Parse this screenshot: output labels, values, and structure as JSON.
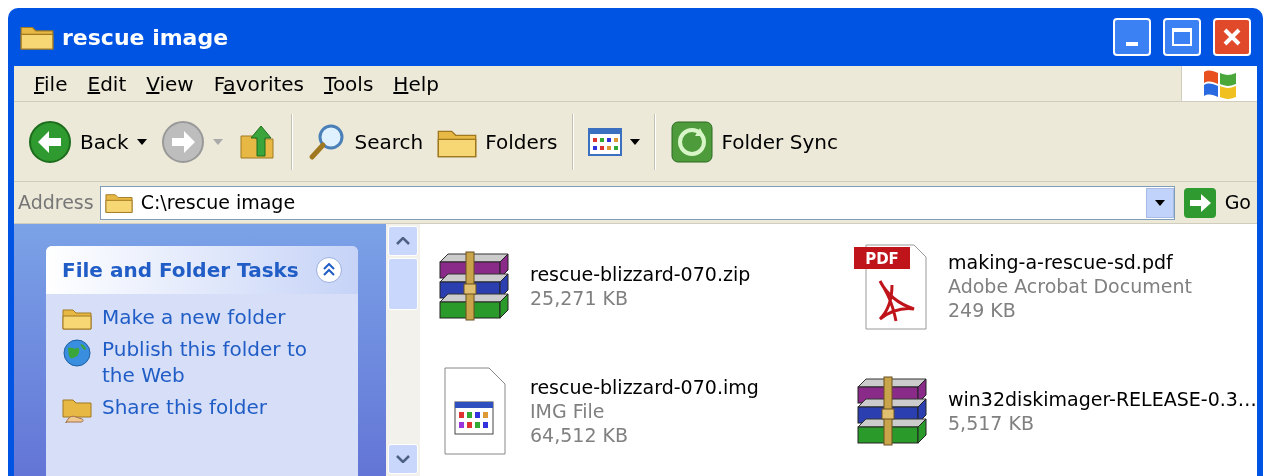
{
  "window": {
    "title": "rescue image"
  },
  "menu": [
    {
      "key": "F",
      "after": "ile"
    },
    {
      "key": "E",
      "after": "dit"
    },
    {
      "key": "V",
      "after": "iew"
    },
    {
      "before": "F",
      "key": "a",
      "after": "vorites"
    },
    {
      "key": "T",
      "after": "ools"
    },
    {
      "key": "H",
      "after": "elp"
    }
  ],
  "toolbar": [
    {
      "kind": "back",
      "label": "Back",
      "disabled": false
    },
    {
      "kind": "forward",
      "disabled": true
    },
    {
      "kind": "up"
    },
    {
      "kind": "search",
      "label": "Search"
    },
    {
      "kind": "folders",
      "label": "Folders"
    },
    {
      "kind": "views"
    },
    {
      "kind": "sync",
      "label": "Folder Sync"
    }
  ],
  "address": {
    "label": "Address",
    "value": "C:\\rescue image",
    "go": "Go"
  },
  "tasks": {
    "title": "File and Folder Tasks",
    "expanded": true,
    "items": [
      {
        "kind": "new-folder",
        "label": "Make a new folder"
      },
      {
        "kind": "publish",
        "label": "Publish this folder to the Web"
      },
      {
        "kind": "share",
        "label": "Share this folder"
      }
    ]
  },
  "files": [
    {
      "kind": "archive",
      "name": "rescue-blizzard-070.zip",
      "lines": [
        "25,271 KB"
      ]
    },
    {
      "kind": "pdf",
      "badge": "PDF",
      "name": "making-a-rescue-sd.pdf",
      "lines": [
        "Adobe Acrobat Document",
        "249 KB"
      ]
    },
    {
      "kind": "image",
      "name": "rescue-blizzard-070.img",
      "lines": [
        "IMG File",
        "64,512 KB"
      ]
    },
    {
      "kind": "archive",
      "name": "win32diskimager-RELEASE-0.3…",
      "lines": [
        "5,517 KB"
      ]
    }
  ]
}
